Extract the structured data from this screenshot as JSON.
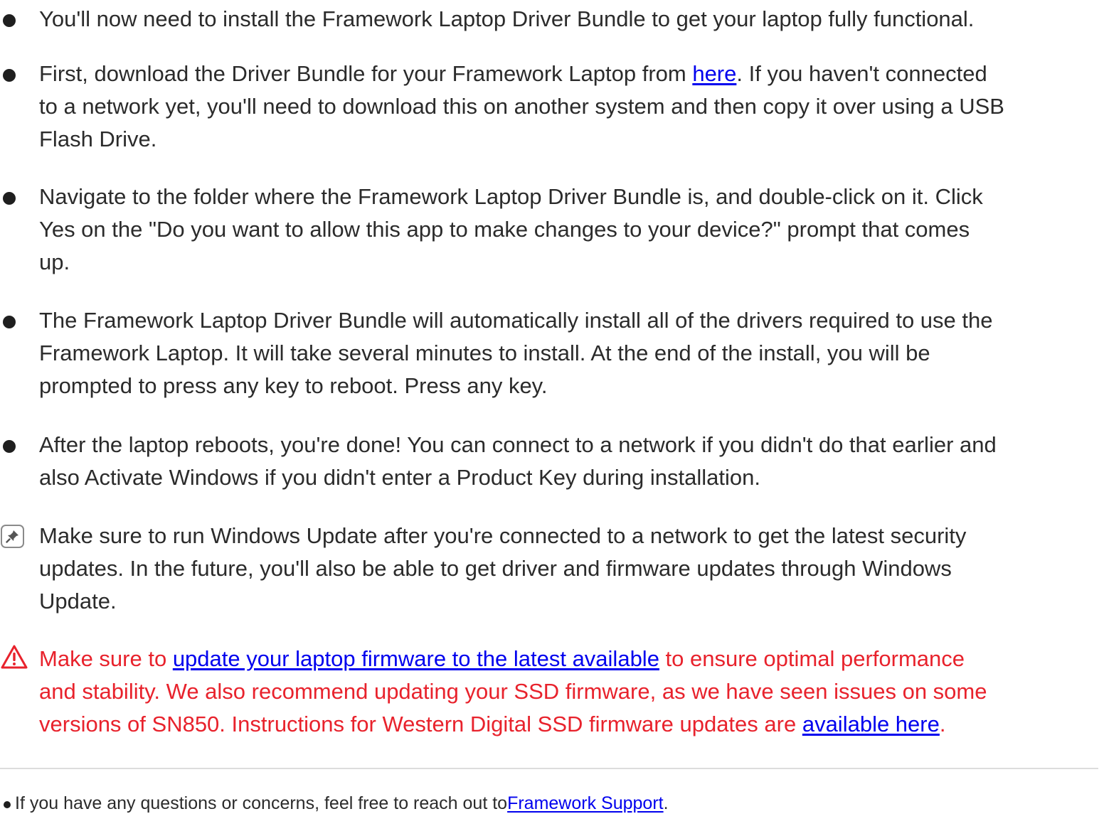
{
  "steps": [
    {
      "lines": [
        "You'll now need to install the Framework Laptop Driver Bundle to get your laptop fully functional."
      ]
    },
    {
      "l1_before": "First, download the Driver Bundle for your Framework Laptop from ",
      "l1_link": "here",
      "l1_after": ". If you haven't connected",
      "l2": "to a network yet, you'll need to download this on another system and then copy it over using a USB",
      "l3": "Flash Drive."
    },
    {
      "lines": [
        "Navigate to the folder where the Framework Laptop Driver Bundle is, and double-click on it. Click",
        "Yes on the \"Do you want to allow this app to make changes to your device?\" prompt that comes",
        "up."
      ]
    },
    {
      "lines": [
        "The Framework Laptop Driver Bundle will automatically install all of the drivers required to use the",
        "Framework Laptop. It will take several minutes to install. At the end of the install, you will be",
        "prompted to press any key to reboot. Press any key."
      ]
    },
    {
      "lines": [
        "After the laptop reboots, you're done! You can connect to a network if you didn't do that earlier and",
        "also Activate Windows if you didn't enter a Product Key during installation."
      ]
    }
  ],
  "note": {
    "icon": "pin-icon",
    "lines": [
      "Make sure to run Windows Update after you're connected to a network to get the latest security",
      "updates. In the future, you'll also be able to get driver and firmware updates through Windows",
      "Update."
    ]
  },
  "warning": {
    "icon": "warning-icon",
    "color": "#e8222c",
    "l1_before": "Make sure to ",
    "l1_link": "update your laptop firmware to the latest available",
    "l1_after": " to ensure optimal performance",
    "l2": "and stability. We also recommend updating your SSD firmware, as we have seen issues on some",
    "l3_before": "versions of SN850. Instructions for Western Digital SSD firmware updates are ",
    "l3_link": "available here",
    "l3_after": "."
  },
  "footer": {
    "text": "If you have any questions or concerns, feel free to reach out to",
    "link": "Framework Support",
    "after": "."
  },
  "colors": {
    "link": "#0000ee",
    "warning": "#e8222c",
    "text": "#2b2b2b"
  }
}
